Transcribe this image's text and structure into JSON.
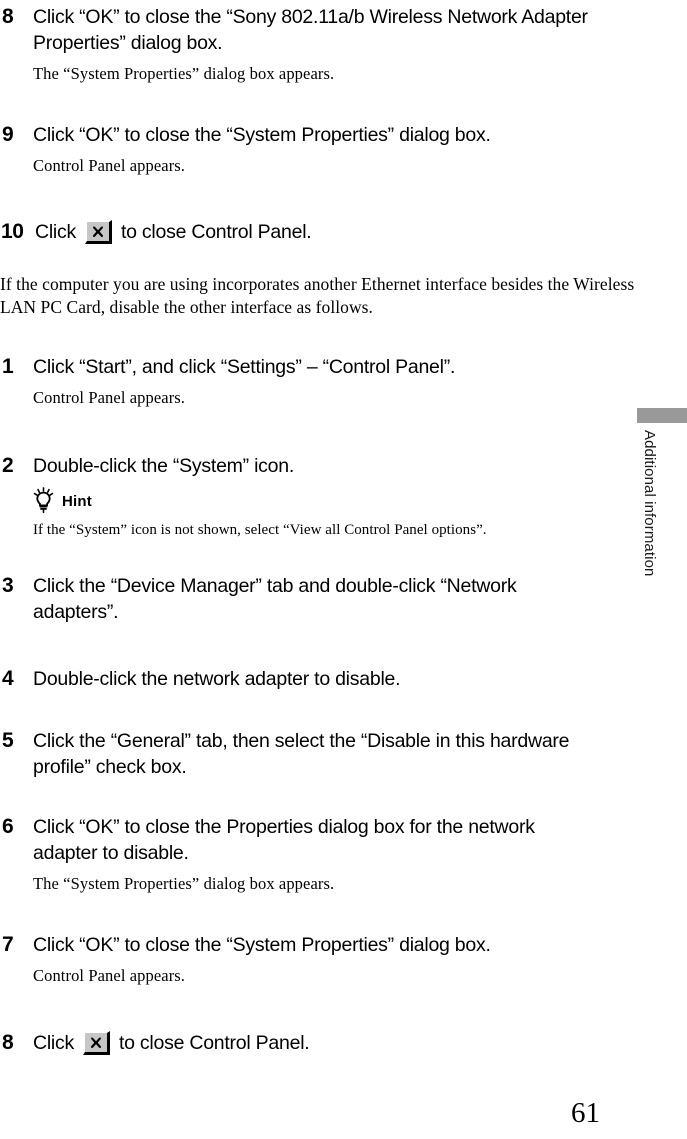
{
  "page": {
    "number": "61",
    "side_tab_label": "Additional information",
    "side_tab_bar_color": "#999999"
  },
  "icons": {
    "close_button": "close-x-button",
    "hint": "lightbulb-icon"
  },
  "section_one": {
    "steps": [
      {
        "number": "8",
        "title": "Click “OK” to close the “Sony 802.11a/b Wireless Network Adapter Properties” dialog box.",
        "note": "The “System Properties” dialog box appears."
      },
      {
        "number": "9",
        "title": "Click “OK” to close the “System Properties” dialog box.",
        "note": "Control Panel appears."
      },
      {
        "number": "10",
        "pre_text": "Click",
        "post_text": "to close Control Panel.",
        "note": ""
      }
    ]
  },
  "intro_paragraph": "If the computer you are using incorporates another Ethernet interface besides the Wireless LAN PC Card, disable the other interface as follows.",
  "section_two": {
    "steps": [
      {
        "number": "1",
        "title": "Click “Start”, and click “Settings” – “Control Panel”.",
        "note": "Control Panel appears."
      },
      {
        "number": "2",
        "title": "Double-click the “System” icon.",
        "hint_label": "Hint",
        "hint_text": "If the “System” icon is not shown, select “View all Control Panel options”."
      },
      {
        "number": "3",
        "title": "Click the “Device Manager” tab and double-click “Network adapters”."
      },
      {
        "number": "4",
        "title": "Double-click the network adapter to disable."
      },
      {
        "number": "5",
        "title": "Click the “General” tab, then select the “Disable in this hardware profile” check box."
      },
      {
        "number": "6",
        "title": "Click “OK” to close the Properties dialog box for the network adapter to disable.",
        "note": "The “System Properties” dialog box appears."
      },
      {
        "number": "7",
        "title": "Click “OK” to close the “System Properties” dialog box.",
        "note": "Control Panel appears."
      },
      {
        "number": "8",
        "pre_text": "Click",
        "post_text": "to close Control Panel.",
        "note": ""
      }
    ]
  }
}
